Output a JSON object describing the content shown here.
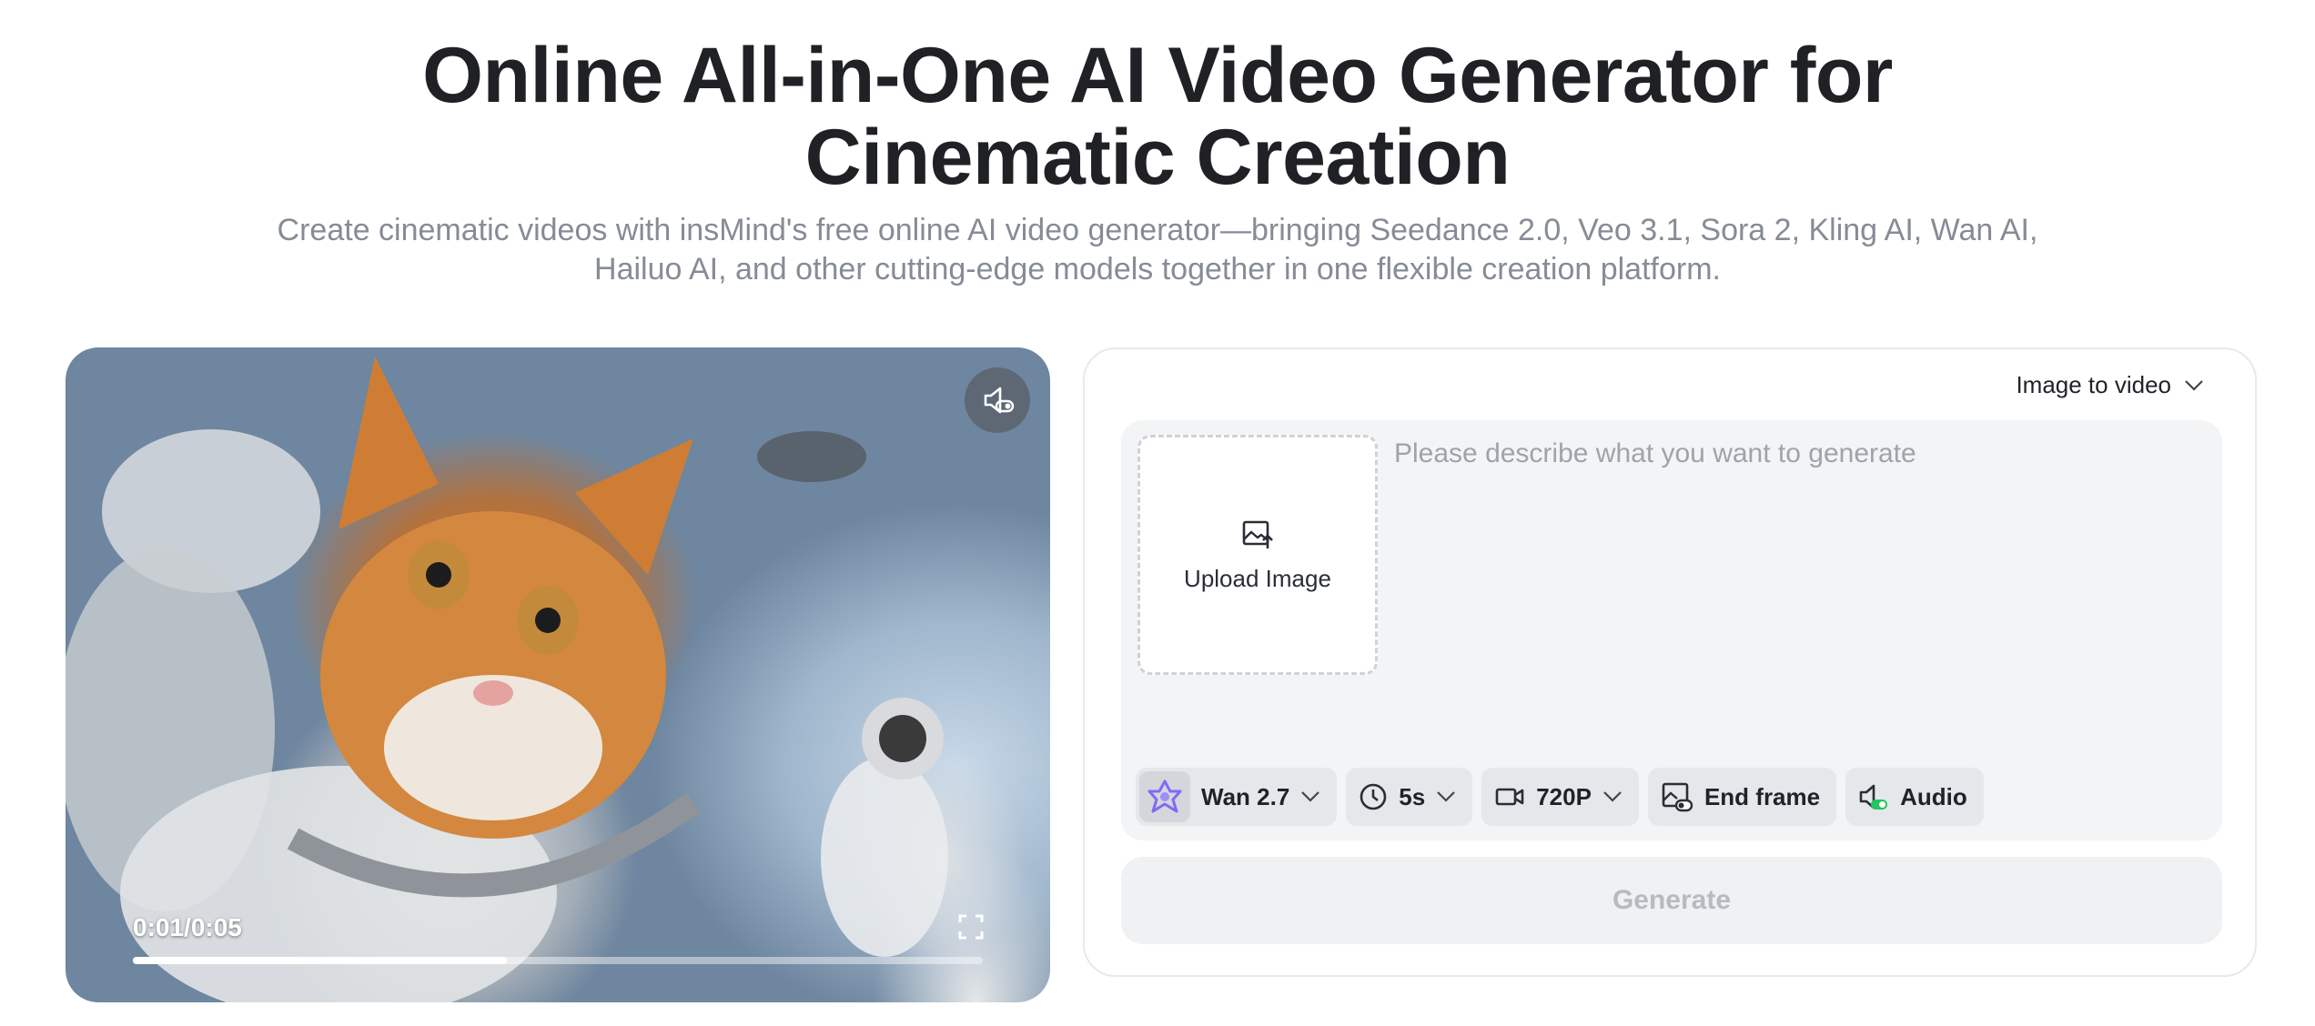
{
  "hero": {
    "title_line1": "Online All-in-One AI Video Generator for",
    "title_line2": "Cinematic Creation",
    "subtitle_line1": "Create cinematic videos with insMind's free online AI video generator—bringing Seedance 2.0, Veo 3.1, Sora 2, Kling AI, Wan AI,",
    "subtitle_line2": "Hailuo AI, and other cutting-edge models together in one flexible creation platform."
  },
  "video": {
    "time": "0:01/0:05",
    "progress": 0.44,
    "icons": {
      "sound": "speaker-muted-icon",
      "fullscreen": "fullscreen-icon"
    }
  },
  "generator": {
    "mode": "Image to video",
    "upload_label": "Upload Image",
    "prompt_placeholder": "Please describe what you want to generate",
    "model": "Wan 2.7",
    "duration": "5s",
    "resolution": "720P",
    "end_frame_label": "End frame",
    "audio_label": "Audio",
    "generate_label": "Generate",
    "colors": {
      "model_icon": "#7b6cf6",
      "audio_toggle": "#22c55e"
    }
  }
}
